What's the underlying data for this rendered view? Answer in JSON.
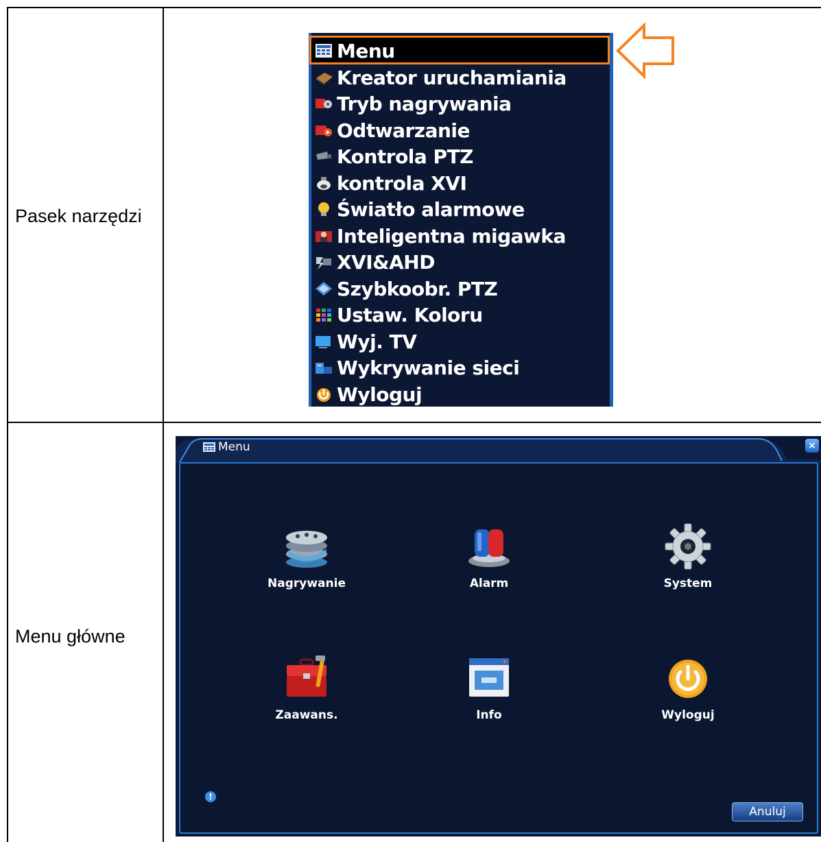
{
  "rows": [
    {
      "label": "Pasek narzędzi"
    },
    {
      "label": "Menu główne"
    }
  ],
  "toolbar": {
    "items": [
      {
        "label": "Menu",
        "icon": "menu-grid-icon"
      },
      {
        "label": "Kreator uruchamiania",
        "icon": "wizard-book-icon"
      },
      {
        "label": "Tryb nagrywania",
        "icon": "record-mode-icon"
      },
      {
        "label": "Odtwarzanie",
        "icon": "playback-icon"
      },
      {
        "label": "Kontrola PTZ",
        "icon": "ptz-camera-icon"
      },
      {
        "label": "kontrola XVI",
        "icon": "dome-camera-icon"
      },
      {
        "label": "Światło alarmowe",
        "icon": "lightbulb-icon"
      },
      {
        "label": "Inteligentna migawka",
        "icon": "snapshot-person-icon"
      },
      {
        "label": "XVI&AHD",
        "icon": "xvi-ahd-icon"
      },
      {
        "label": "Szybkoobr. PTZ",
        "icon": "ptz-quick-icon"
      },
      {
        "label": "Ustaw. Koloru",
        "icon": "color-grid-icon"
      },
      {
        "label": "Wyj. TV",
        "icon": "tv-output-icon"
      },
      {
        "label": "Wykrywanie sieci",
        "icon": "network-detect-icon"
      },
      {
        "label": "Wyloguj",
        "icon": "power-icon"
      }
    ],
    "highlight_color": "#f58220"
  },
  "main_menu": {
    "title": "Menu",
    "tiles": [
      {
        "label": "Nagrywanie",
        "icon": "film-reels-icon"
      },
      {
        "label": "Alarm",
        "icon": "siren-icon"
      },
      {
        "label": "System",
        "icon": "gear-icon"
      },
      {
        "label": "Zaawans.",
        "icon": "toolbox-icon"
      },
      {
        "label": "Info",
        "icon": "info-window-icon"
      },
      {
        "label": "Wyloguj",
        "icon": "power-icon"
      }
    ],
    "cancel_label": "Anuluj",
    "close_glyph": "×",
    "info_glyph": "!"
  },
  "colors": {
    "screen_bg": "#0c1733",
    "accent_blue": "#2b7ad8",
    "text": "#ffffff"
  }
}
